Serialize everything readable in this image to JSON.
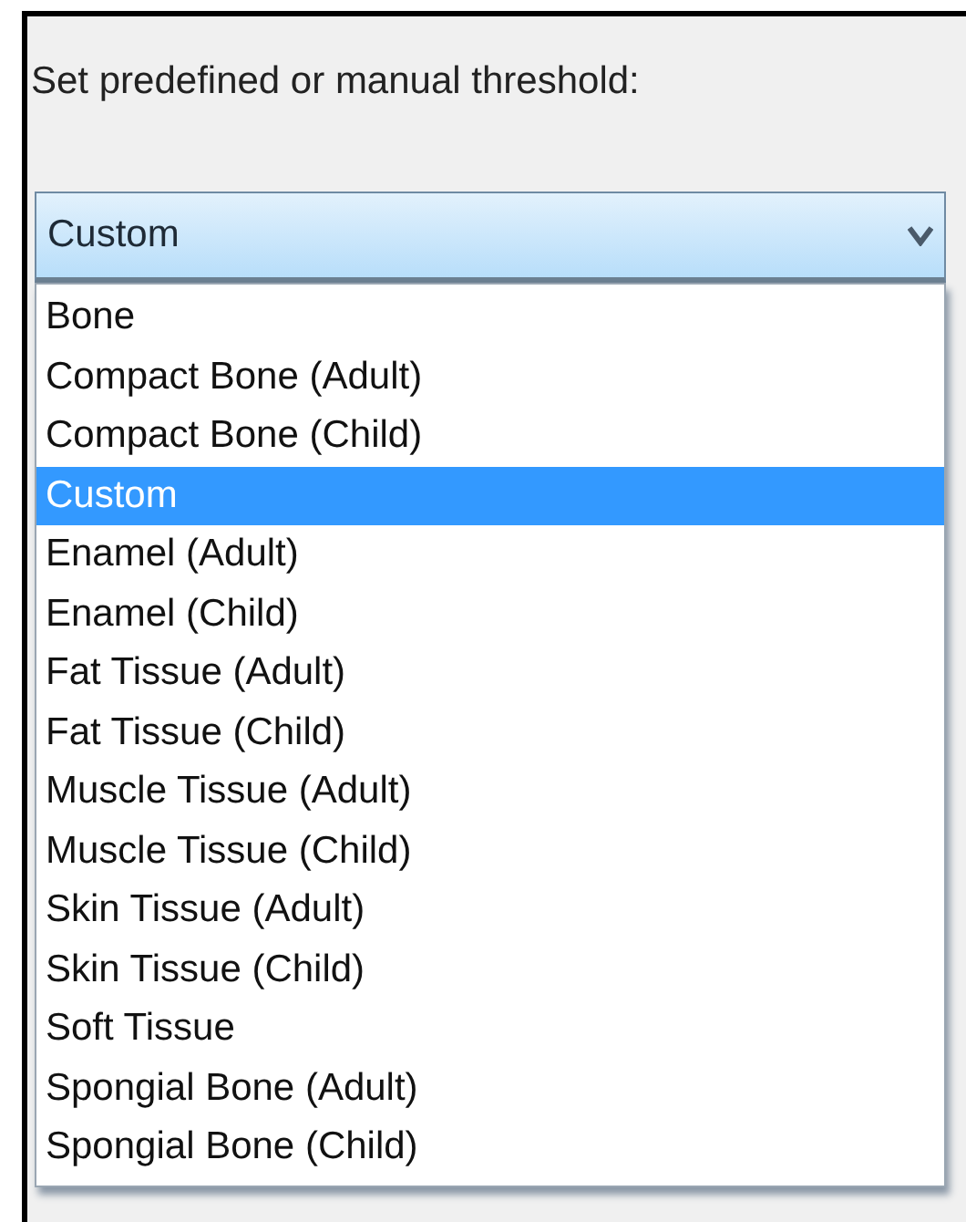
{
  "label": "Set predefined or manual threshold:",
  "dropdown": {
    "value": "Custom",
    "expanded": true
  },
  "options": [
    {
      "label": "Bone",
      "selected": false
    },
    {
      "label": "Compact Bone (Adult)",
      "selected": false
    },
    {
      "label": "Compact Bone (Child)",
      "selected": false
    },
    {
      "label": "Custom",
      "selected": true
    },
    {
      "label": "Enamel (Adult)",
      "selected": false
    },
    {
      "label": "Enamel (Child)",
      "selected": false
    },
    {
      "label": "Fat Tissue (Adult)",
      "selected": false
    },
    {
      "label": "Fat Tissue (Child)",
      "selected": false
    },
    {
      "label": "Muscle Tissue (Adult)",
      "selected": false
    },
    {
      "label": "Muscle Tissue (Child)",
      "selected": false
    },
    {
      "label": "Skin Tissue (Adult)",
      "selected": false
    },
    {
      "label": "Skin Tissue (Child)",
      "selected": false
    },
    {
      "label": "Soft Tissue",
      "selected": false
    },
    {
      "label": "Spongial Bone (Adult)",
      "selected": false
    },
    {
      "label": "Spongial Bone (Child)",
      "selected": false
    }
  ]
}
